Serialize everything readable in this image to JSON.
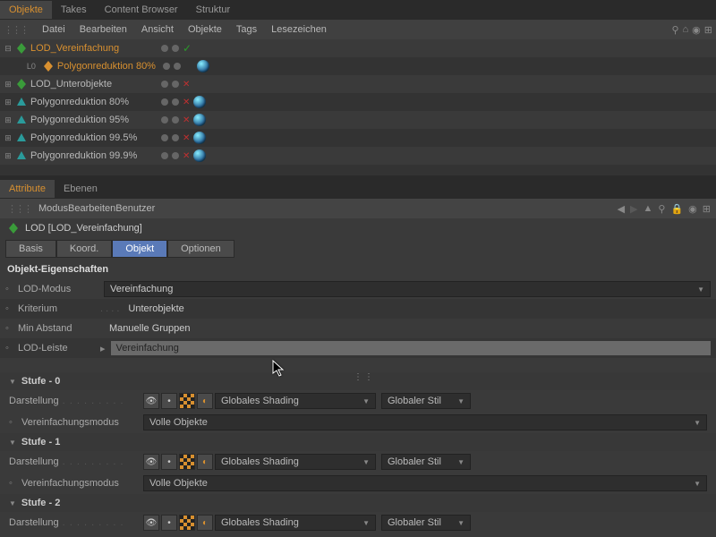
{
  "tabs": {
    "objekte": "Objekte",
    "takes": "Takes",
    "content": "Content Browser",
    "struktur": "Struktur"
  },
  "menu": {
    "datei": "Datei",
    "bearbeiten": "Bearbeiten",
    "ansicht": "Ansicht",
    "objekte": "Objekte",
    "tags": "Tags",
    "lesezeichen": "Lesezeichen"
  },
  "tree": [
    {
      "name": "LOD_Vereinfachung",
      "sel": true,
      "icon": "leaf-green",
      "exp": "-"
    },
    {
      "name": "Polygonreduktion 80%",
      "sel": true,
      "indent": 2,
      "icon": "leaf-orange",
      "l0": "L0",
      "sphere": true
    },
    {
      "name": "LOD_Unterobjekte",
      "icon": "leaf-green",
      "exp": "+",
      "cross": true
    },
    {
      "name": "Polygonreduktion 80%",
      "icon": "tri-teal",
      "exp": "+",
      "sphere": true,
      "cross": true
    },
    {
      "name": "Polygonreduktion 95%",
      "icon": "tri-teal",
      "exp": "+",
      "sphere": true,
      "cross": true
    },
    {
      "name": "Polygonreduktion 99.5%",
      "icon": "tri-teal",
      "exp": "+",
      "sphere": true,
      "cross": true
    },
    {
      "name": "Polygonreduktion 99.9%",
      "icon": "tri-teal",
      "exp": "+",
      "sphere": true,
      "cross": true
    }
  ],
  "attr_tabs": {
    "attribute": "Attribute",
    "ebenen": "Ebenen"
  },
  "attr_menu": {
    "modus": "Modus",
    "bearbeiten": "Bearbeiten",
    "benutzer": "Benutzer"
  },
  "obj_title": "LOD [LOD_Vereinfachung]",
  "prop_tabs": {
    "basis": "Basis",
    "koord": "Koord.",
    "objekt": "Objekt",
    "optionen": "Optionen"
  },
  "section": "Objekt-Eigenschaften",
  "props": {
    "lod_modus": {
      "label": "LOD-Modus",
      "value": "Vereinfachung"
    },
    "kriterium": {
      "label": "Kriterium",
      "value": "Unterobjekte"
    },
    "min_abstand": {
      "label": "Min Abstand",
      "value": "Manuelle Gruppen"
    },
    "lod_leiste": {
      "label": "LOD-Leiste",
      "value": "Vereinfachung"
    }
  },
  "stages": {
    "s0": "Stufe - 0",
    "s1": "Stufe - 1",
    "s2": "Stufe - 2",
    "darstellung": "Darstellung",
    "vereinfachung": "Vereinfachungsmodus",
    "shading": "Globales Shading",
    "stil": "Globaler Stil",
    "volle": "Volle Objekte"
  }
}
